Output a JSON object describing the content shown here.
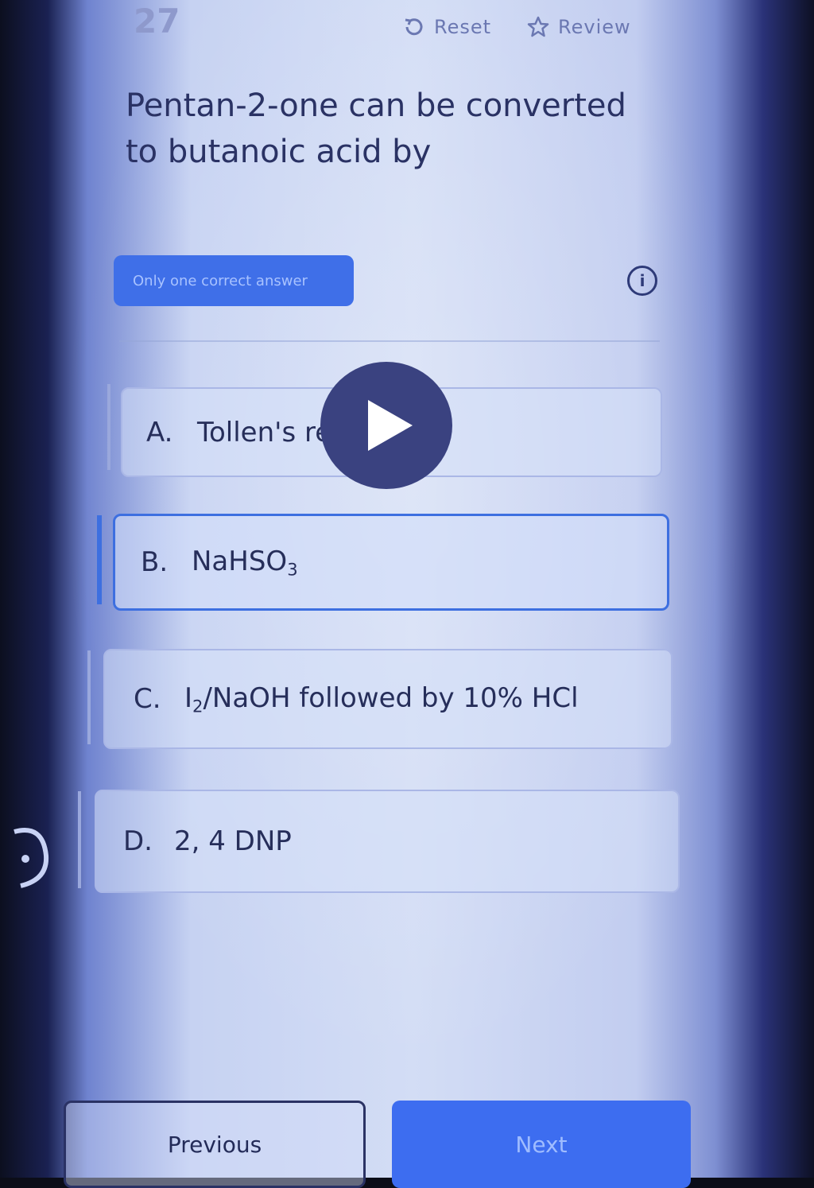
{
  "header": {
    "question_number": "27",
    "reset_label": "Reset",
    "review_label": "Review"
  },
  "question": {
    "text": "Pentan-2-one can be converted to butanoic acid by",
    "answer_type": "Only one correct answer"
  },
  "options": [
    {
      "letter": "A.",
      "text_before": "Tollen's reag",
      "text_after": "t"
    },
    {
      "letter": "B.",
      "text": "NaHSO",
      "sub": "3"
    },
    {
      "letter": "C.",
      "text_pre": "I",
      "sub": "2",
      "text_post": "/NaOH followed by 10% HCl"
    },
    {
      "letter": "D.",
      "text": "2, 4 DNP"
    }
  ],
  "navigation": {
    "previous_label": "Previous",
    "next_label": "Next"
  },
  "icons": {
    "reset": "reset-icon",
    "review": "star-outline-icon",
    "info": "info-icon",
    "play": "play-icon"
  },
  "colors": {
    "accent": "#3d6df0",
    "pill": "#3f6fe8",
    "text_dark": "#262e5a"
  }
}
